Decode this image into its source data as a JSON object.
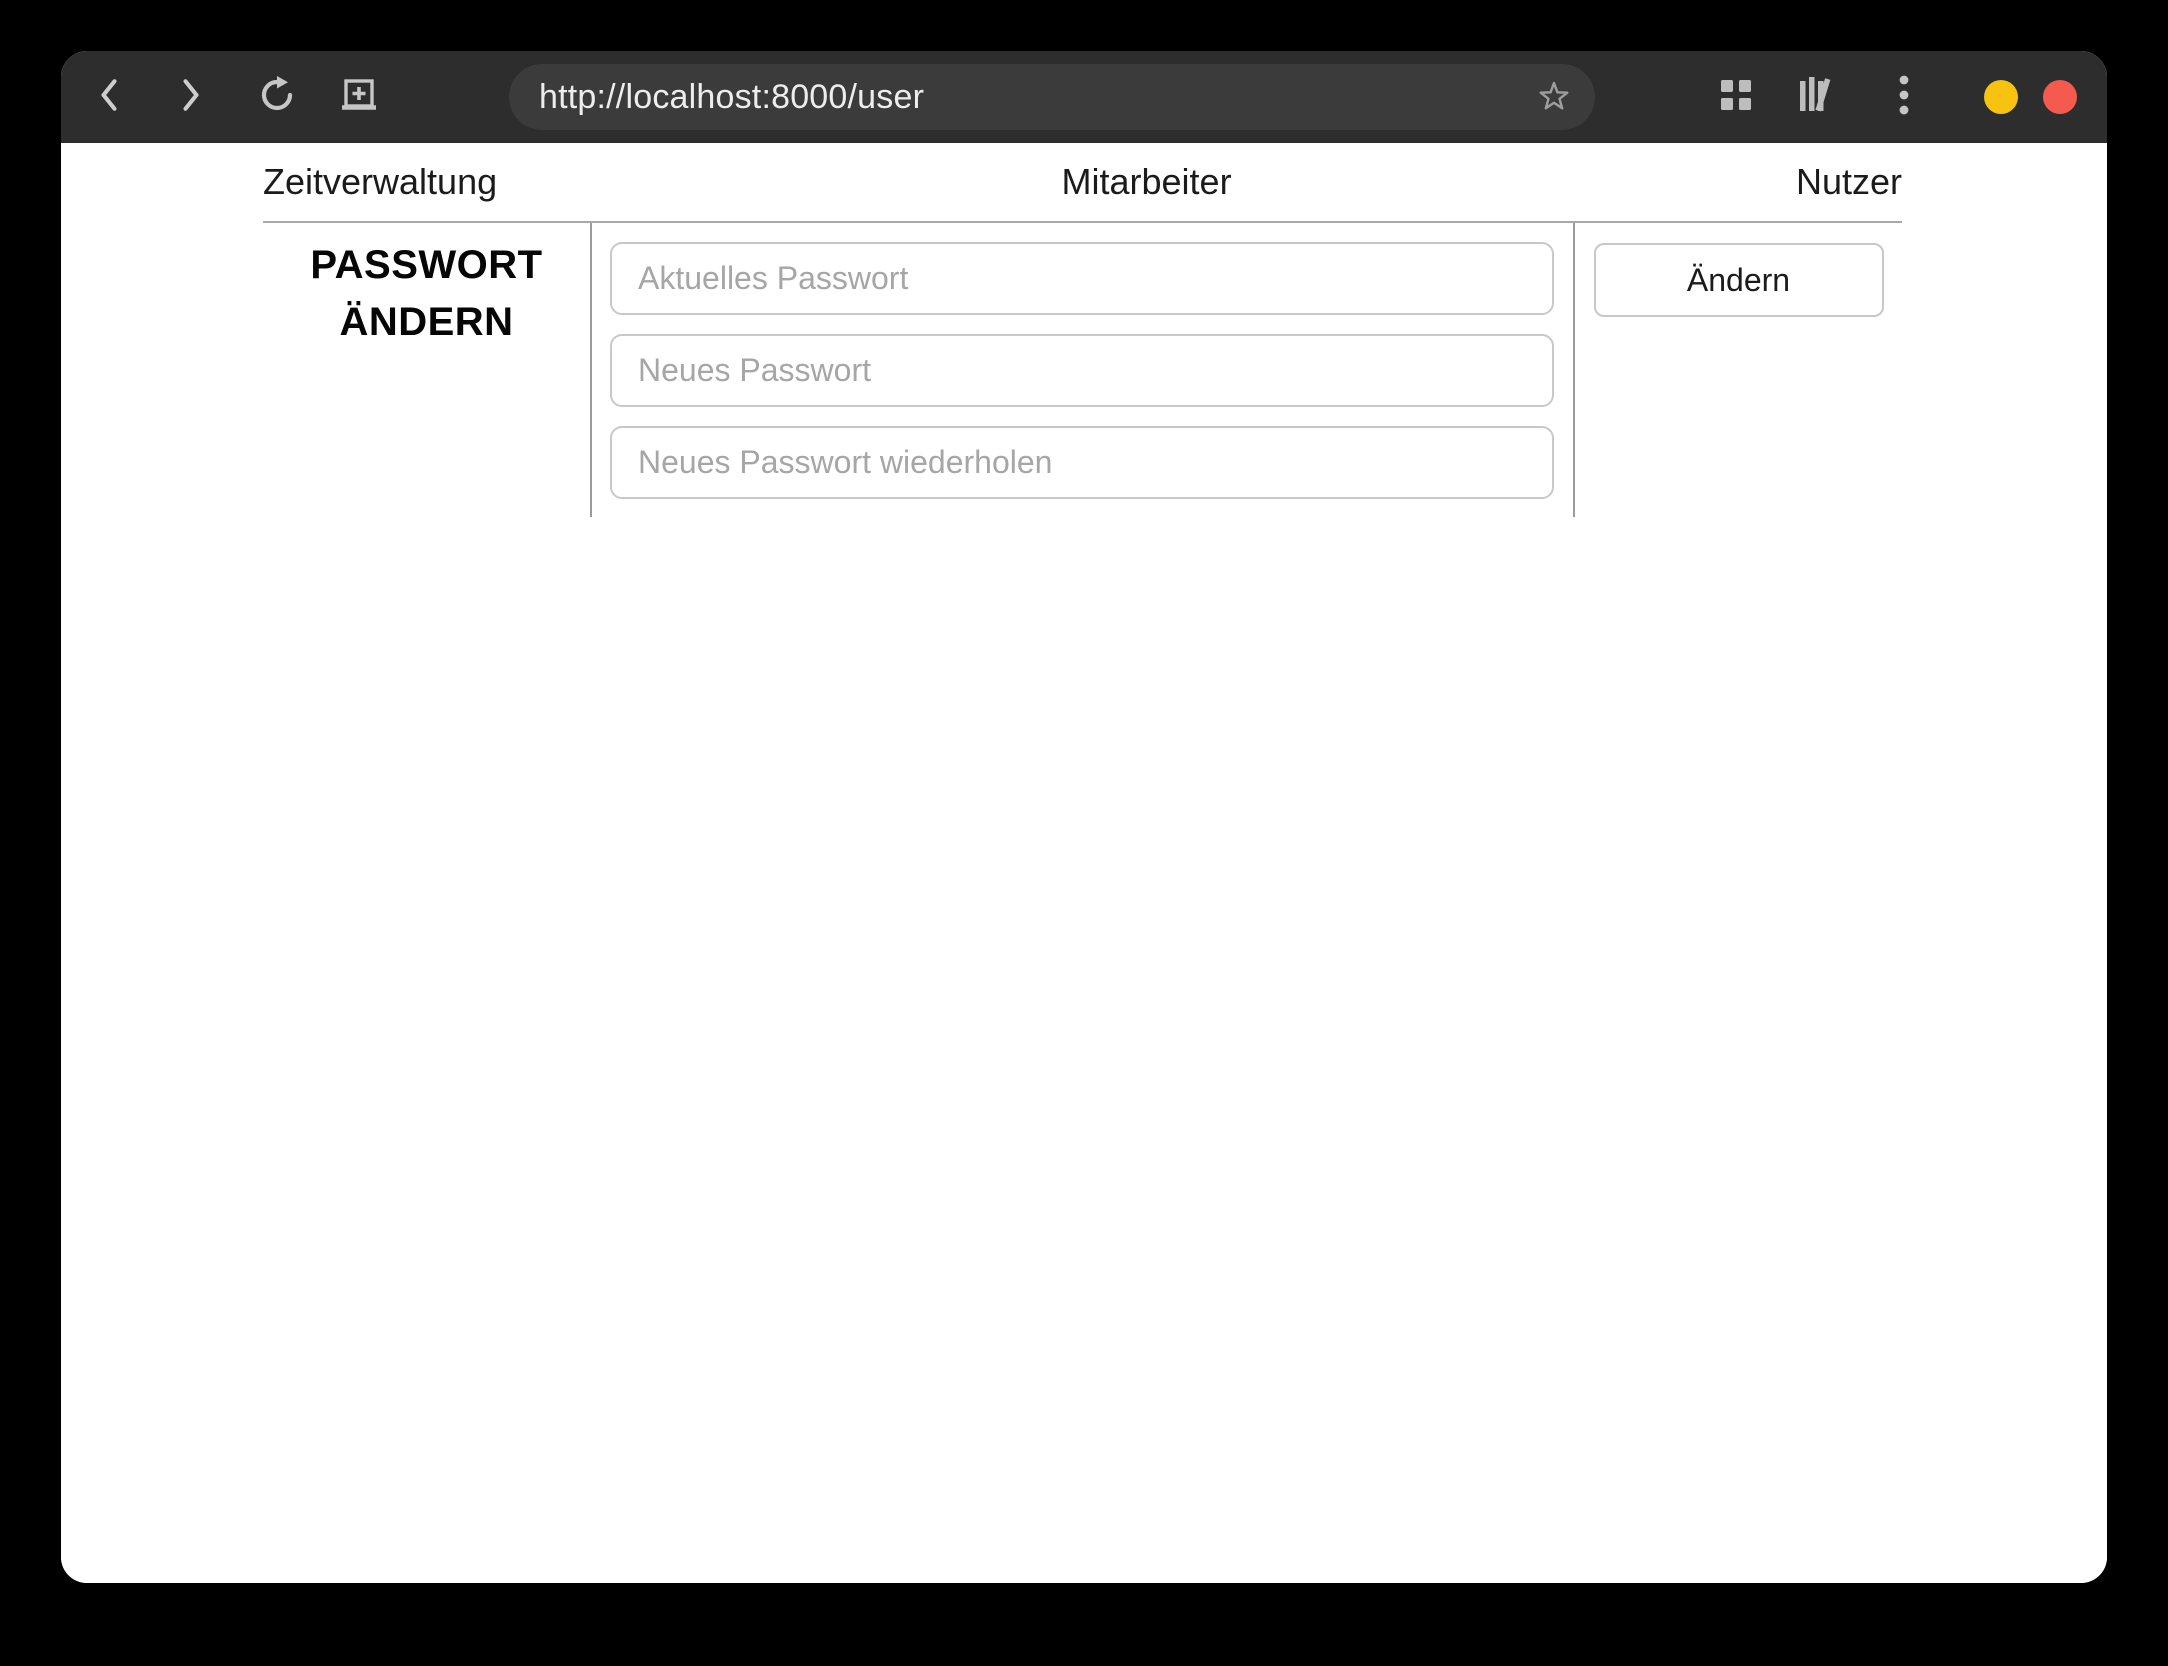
{
  "browser": {
    "url": "http://localhost:8000/user",
    "toolbar": {
      "back_icon": "chevron-left",
      "forward_icon": "chevron-right",
      "reload_icon": "circular-arrow",
      "new_tab_icon": "window-plus",
      "bookmark_icon": "star-outline",
      "pages_overview_icon": "grid-four-squares",
      "library_icon": "books",
      "menu_icon": "kebab-three-dots"
    },
    "window_buttons": {
      "minimize_color": "#f8c211",
      "close_color": "#f45b4e"
    },
    "colors": {
      "chrome_bg": "#2d2d2d",
      "urlbar_bg": "#3b3b3b",
      "icon_gray": "#c6c6c6"
    }
  },
  "nav": {
    "items": [
      {
        "label": "Zeitverwaltung"
      },
      {
        "label": "Mitarbeiter"
      },
      {
        "label": "Nutzer"
      }
    ]
  },
  "form": {
    "heading_lines": [
      "PASSWORT",
      "ÄNDERN"
    ],
    "fields": [
      {
        "placeholder": "Aktuelles Passwort",
        "value": ""
      },
      {
        "placeholder": "Neues Passwort",
        "value": ""
      },
      {
        "placeholder": "Neues Passwort wiederholen",
        "value": ""
      }
    ],
    "submit_label": "Ändern"
  }
}
